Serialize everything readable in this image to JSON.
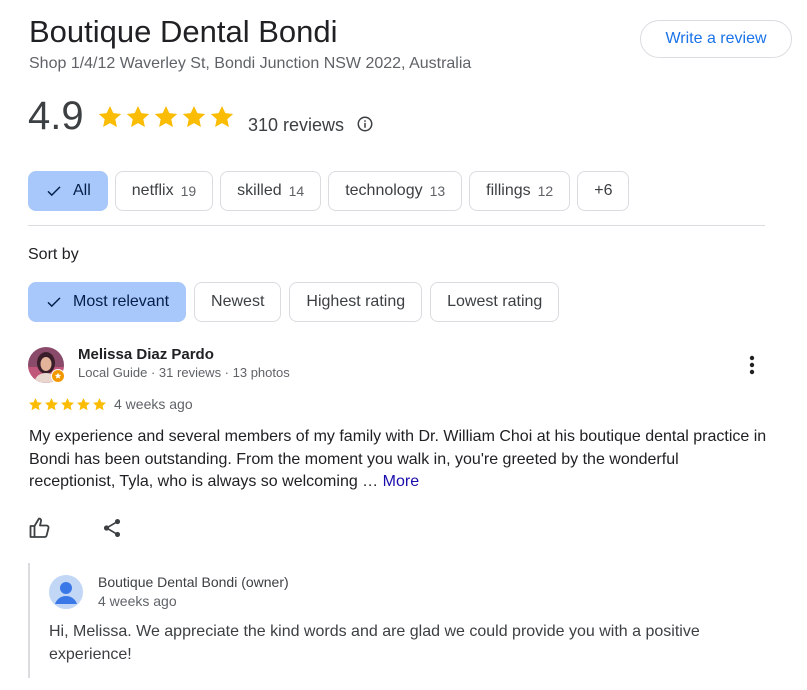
{
  "business": {
    "name": "Boutique Dental Bondi",
    "address": "Shop 1/4/12 Waverley St, Bondi Junction NSW 2022, Australia",
    "write_review_label": "Write a review",
    "rating": "4.9",
    "stars": 5,
    "review_count": "310 reviews"
  },
  "topic_chips": [
    {
      "label": "All",
      "count": "",
      "selected": true
    },
    {
      "label": "netflix",
      "count": "19",
      "selected": false
    },
    {
      "label": "skilled",
      "count": "14",
      "selected": false
    },
    {
      "label": "technology",
      "count": "13",
      "selected": false
    },
    {
      "label": "fillings",
      "count": "12",
      "selected": false
    },
    {
      "label": "+6",
      "count": "",
      "selected": false
    }
  ],
  "sort": {
    "label": "Sort by",
    "options": [
      {
        "label": "Most relevant",
        "selected": true
      },
      {
        "label": "Newest",
        "selected": false
      },
      {
        "label": "Highest rating",
        "selected": false
      },
      {
        "label": "Lowest rating",
        "selected": false
      }
    ]
  },
  "review": {
    "author": "Melissa Diaz Pardo",
    "meta": "Local Guide · 31 reviews · 13 photos",
    "stars": 5,
    "time": "4 weeks ago",
    "text": "My experience and several members of my family with Dr. William Choi at his boutique dental practice in Bondi has been outstanding. From the moment you walk in, you're greeted by the wonderful receptionist, Tyla, who is always so welcoming …",
    "more_label": "More"
  },
  "owner_reply": {
    "name": "Boutique Dental Bondi (owner)",
    "time": "4 weeks ago",
    "text": "Hi, Melissa. We appreciate the kind words and are glad we could provide you with a positive experience!"
  },
  "colors": {
    "star": "#fbbc04",
    "chip_selected": "#a8c7fa",
    "link": "#1a0dab",
    "accent": "#1a73e8"
  }
}
